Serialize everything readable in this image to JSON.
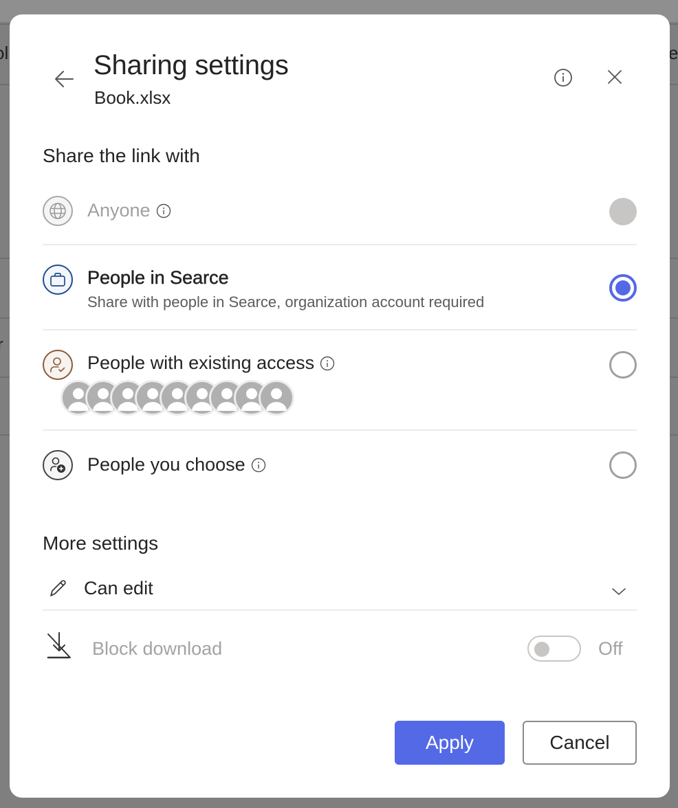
{
  "background": {
    "left_text_fragments": [
      "ol",
      "r"
    ],
    "right_text_fragments": [
      "e"
    ]
  },
  "dialog": {
    "title": "Sharing settings",
    "subtitle": "Book.xlsx",
    "icons": {
      "back": "arrow-left-icon",
      "info": "info-icon",
      "close": "close-icon"
    }
  },
  "share_section": {
    "title": "Share the link with",
    "options": [
      {
        "id": "anyone",
        "label": "Anyone",
        "icon": "globe-icon",
        "has_info": true,
        "state": "disabled"
      },
      {
        "id": "people-in-org",
        "label": "People in Searce",
        "description": "Share with people in Searce, organization account required",
        "icon": "briefcase-icon",
        "has_info": false,
        "state": "selected"
      },
      {
        "id": "existing-access",
        "label": "People with existing access",
        "icon": "person-check-icon",
        "has_info": true,
        "state": "unselected",
        "avatar_count": 9
      },
      {
        "id": "people-you-choose",
        "label": "People you choose",
        "icon": "person-add-icon",
        "has_info": true,
        "state": "unselected"
      }
    ]
  },
  "more_settings": {
    "title": "More settings",
    "permission": {
      "value": "Can edit",
      "icon": "pencil-icon"
    },
    "block_download": {
      "label": "Block download",
      "icon": "download-blocked-icon",
      "toggle_state": "Off",
      "enabled": false
    }
  },
  "footer": {
    "apply_label": "Apply",
    "cancel_label": "Cancel"
  },
  "colors": {
    "accent": "#5469e6",
    "disabled": "#c8c6c4",
    "briefcase_ring": "#1f4e8c",
    "person_check_ring": "#8a5a3a"
  }
}
